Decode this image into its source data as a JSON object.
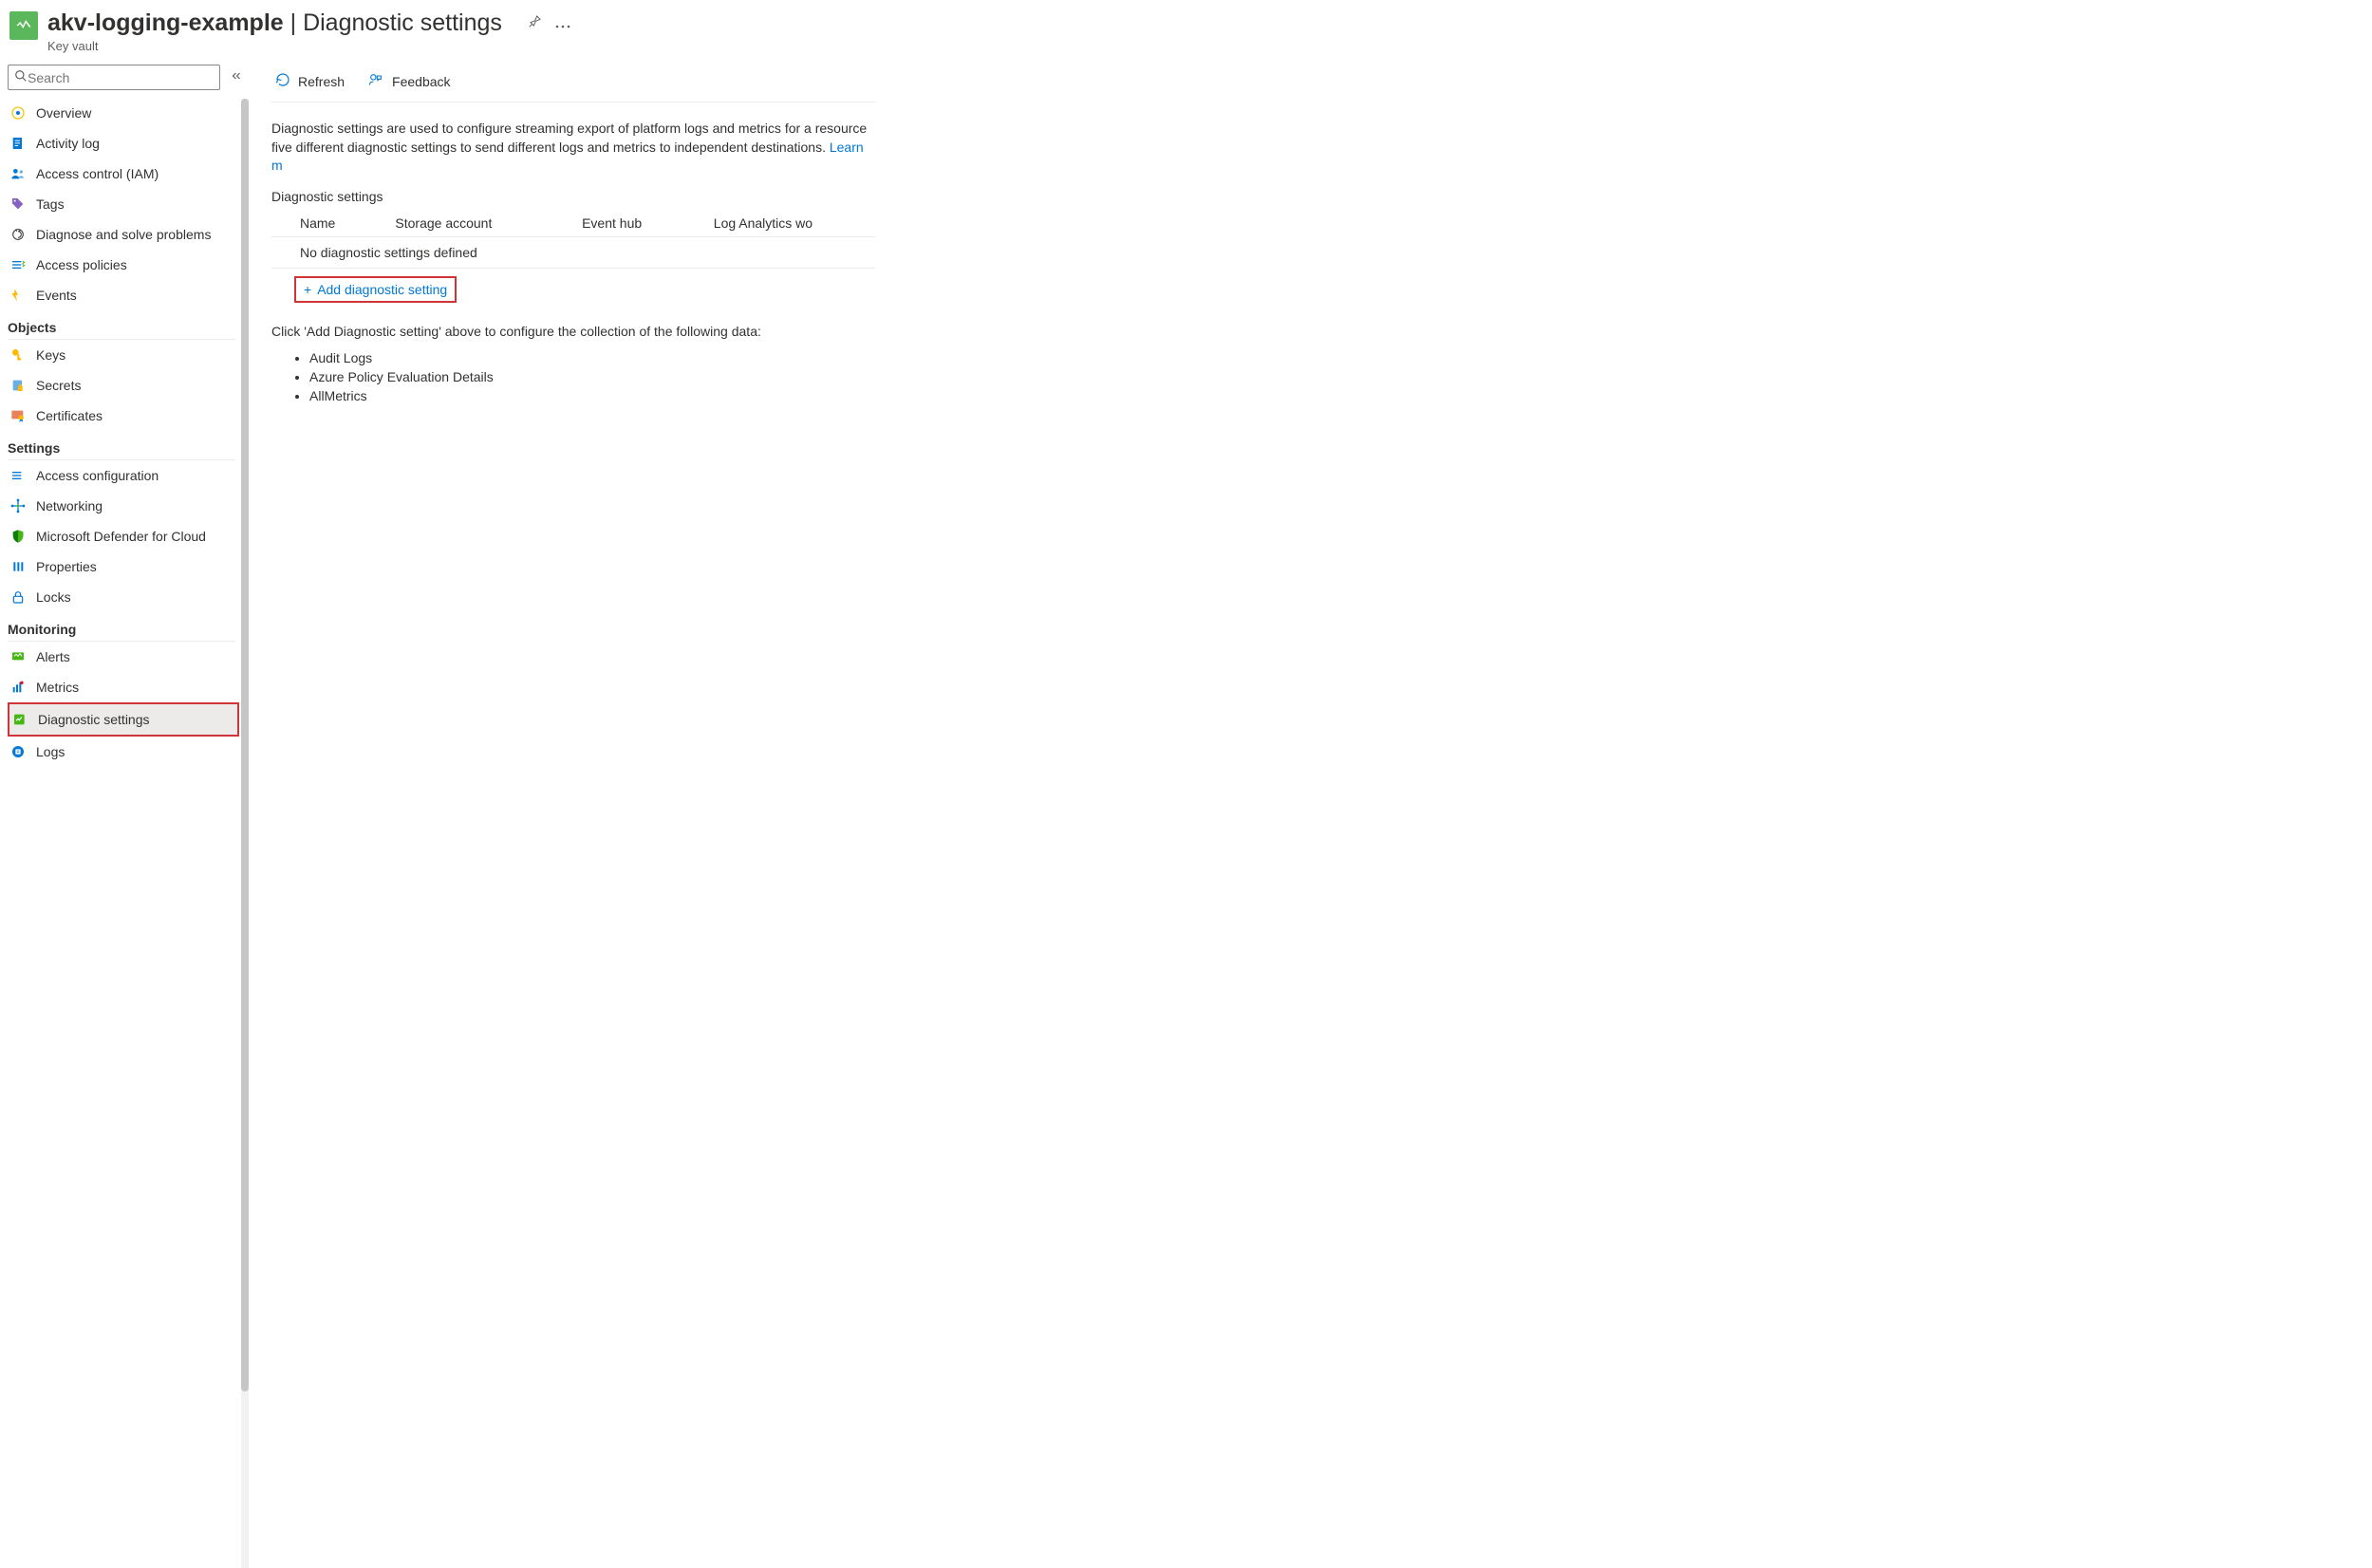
{
  "header": {
    "resource_name": "akv-logging-example",
    "separator": " | ",
    "page_name": "Diagnostic settings",
    "subtitle": "Key vault"
  },
  "sidebar": {
    "search_placeholder": "Search",
    "top_items": [
      {
        "label": "Overview",
        "icon": "overview"
      },
      {
        "label": "Activity log",
        "icon": "activitylog"
      },
      {
        "label": "Access control (IAM)",
        "icon": "iam"
      },
      {
        "label": "Tags",
        "icon": "tags"
      },
      {
        "label": "Diagnose and solve problems",
        "icon": "diagnose"
      },
      {
        "label": "Access policies",
        "icon": "accesspolicies"
      },
      {
        "label": "Events",
        "icon": "events"
      }
    ],
    "sections": [
      {
        "title": "Objects",
        "items": [
          {
            "label": "Keys",
            "icon": "keys"
          },
          {
            "label": "Secrets",
            "icon": "secrets"
          },
          {
            "label": "Certificates",
            "icon": "certificates"
          }
        ]
      },
      {
        "title": "Settings",
        "items": [
          {
            "label": "Access configuration",
            "icon": "accessconfig"
          },
          {
            "label": "Networking",
            "icon": "networking"
          },
          {
            "label": "Microsoft Defender for Cloud",
            "icon": "defender"
          },
          {
            "label": "Properties",
            "icon": "properties"
          },
          {
            "label": "Locks",
            "icon": "locks"
          }
        ]
      },
      {
        "title": "Monitoring",
        "items": [
          {
            "label": "Alerts",
            "icon": "alerts"
          },
          {
            "label": "Metrics",
            "icon": "metrics"
          },
          {
            "label": "Diagnostic settings",
            "icon": "diagsettings",
            "selected": true,
            "highlighted": true
          },
          {
            "label": "Logs",
            "icon": "logs"
          }
        ]
      }
    ]
  },
  "toolbar": {
    "refresh_label": "Refresh",
    "feedback_label": "Feedback"
  },
  "main": {
    "description": "Diagnostic settings are used to configure streaming export of platform logs and metrics for a resource five different diagnostic settings to send different logs and metrics to independent destinations. ",
    "learn_label": "Learn m",
    "section_label": "Diagnostic settings",
    "columns": [
      "Name",
      "Storage account",
      "Event hub",
      "Log Analytics wo"
    ],
    "empty_row": "No diagnostic settings defined",
    "add_label": "Add diagnostic setting",
    "hint": "Click 'Add Diagnostic setting' above to configure the collection of the following data:",
    "bullets": [
      "Audit Logs",
      "Azure Policy Evaluation Details",
      "AllMetrics"
    ]
  }
}
